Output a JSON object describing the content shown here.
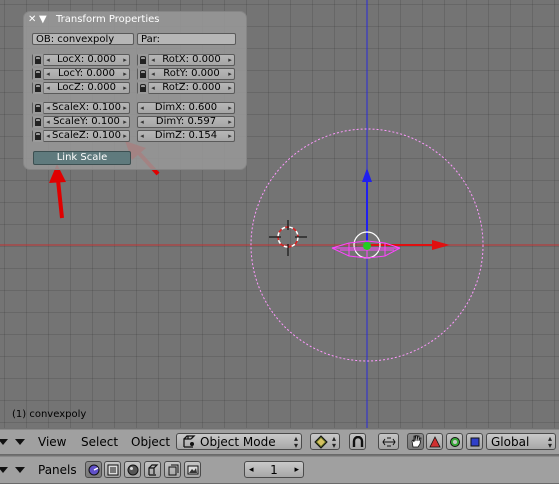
{
  "panel": {
    "close_glyph": "✕",
    "collapse_glyph": "▼",
    "title": "Transform Properties",
    "ob_field": "OB: convexpoly",
    "par_field": "Par:",
    "loc": [
      "LocX: 0.000",
      "LocY: 0.000",
      "LocZ: 0.000"
    ],
    "rot": [
      "RotX: 0.000",
      "RotY: 0.000",
      "RotZ: 0.000"
    ],
    "scale": [
      "ScaleX: 0.100",
      "ScaleY: 0.100",
      "ScaleZ: 0.100"
    ],
    "dim": [
      "DimX: 0.600",
      "DimY: 0.597",
      "DimZ: 0.154"
    ],
    "link_scale": "Link Scale",
    "arrow_left": "◂",
    "arrow_right": "▸"
  },
  "viewport": {
    "status_text": "(1) convexpoly",
    "colors": {
      "x_axis": "#c03030",
      "z_axis": "#2a2ad8",
      "selection": "#ff44ff",
      "annotation_arrow": "#e00000",
      "object_center": "#22cc22"
    }
  },
  "header": {
    "menu_view": "View",
    "menu_select": "Select",
    "menu_object": "Object",
    "mode": "Object Mode",
    "orientation": "Global",
    "icons": [
      "mesh-draw-type-icon",
      "magnet-icon",
      "translate-manipulator-icon",
      "hand-icon",
      "rotate-manipulator-icon",
      "scale-manipulator-icon",
      "square-icon"
    ]
  },
  "buttons_window": {
    "panels_label": "Panels",
    "frame_value": "1",
    "frame_left_glyph": "◂",
    "frame_right_glyph": "▸"
  }
}
